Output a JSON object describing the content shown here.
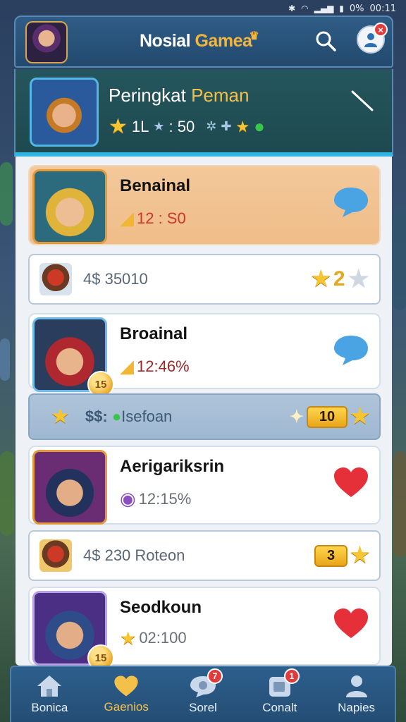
{
  "status_bar": {
    "time": "00:11",
    "battery": "0%"
  },
  "header": {
    "title_main": "Nosial ",
    "title_accent": "Gamea"
  },
  "rank_banner": {
    "title_main": "Peringkat ",
    "title_accent": "Peman",
    "stat_prefix": "1L",
    "stat_value": ": 50"
  },
  "players": [
    {
      "name": "Benainal",
      "stat": "12 : S0",
      "stat_color": "#d0352b",
      "action_icon": "chat-bubble-icon",
      "highlight": true
    },
    {
      "name": "Broainal",
      "stat": "12:46%",
      "stat_color": "#9a2a2a",
      "action_icon": "chat-bubble-icon",
      "coin": "15"
    },
    {
      "name": "Aerigariksrin",
      "stat": "12:15%",
      "stat_color": "#6a6f78",
      "action_icon": "heart-icon"
    },
    {
      "name": "Seodkoun",
      "stat": "02:100",
      "stat_color": "#6a6f78",
      "action_icon": "heart-icon",
      "coin": "15"
    }
  ],
  "sub_rows": [
    {
      "text": "4$ 35010",
      "right_value": "2"
    },
    {
      "text": "$$: ",
      "text_extra": "Isefoan",
      "right_value": "10"
    },
    {
      "text": "4$ 230 Roteon",
      "right_value": "3"
    }
  ],
  "nav": [
    {
      "label": "Bonica",
      "icon": "home-icon"
    },
    {
      "label": "Gaenios",
      "icon": "heart-icon",
      "active": true
    },
    {
      "label": "Sorel",
      "icon": "chat-icon",
      "badge": "7"
    },
    {
      "label": "Conalt",
      "icon": "contact-icon",
      "badge": "1"
    },
    {
      "label": "Napies",
      "icon": "person-icon"
    }
  ],
  "colors": {
    "accent_gold": "#f3c04a",
    "heart_red": "#e5303a",
    "chat_blue": "#4aa3e3",
    "header_blue": "#2f5d86"
  }
}
